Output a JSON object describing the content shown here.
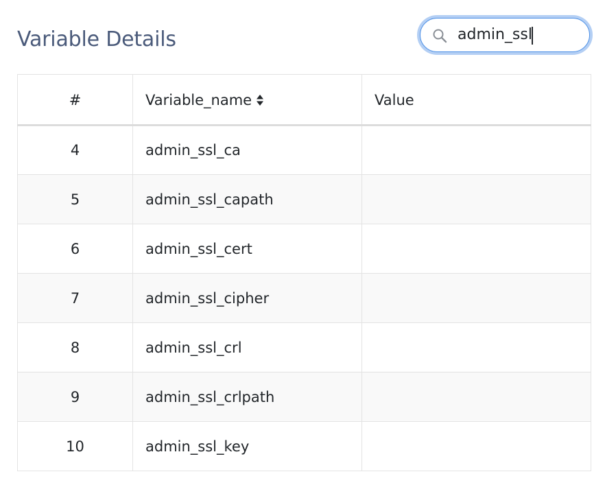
{
  "header": {
    "title": "Variable Details"
  },
  "search": {
    "value": "admin_ssl",
    "icon": "search-icon"
  },
  "table": {
    "columns": [
      "#",
      "Variable_name",
      "Value"
    ],
    "sort_icon": "sort-icon",
    "rows": [
      {
        "num": "4",
        "name": "admin_ssl_ca",
        "value": ""
      },
      {
        "num": "5",
        "name": "admin_ssl_capath",
        "value": ""
      },
      {
        "num": "6",
        "name": "admin_ssl_cert",
        "value": ""
      },
      {
        "num": "7",
        "name": "admin_ssl_cipher",
        "value": ""
      },
      {
        "num": "8",
        "name": "admin_ssl_crl",
        "value": ""
      },
      {
        "num": "9",
        "name": "admin_ssl_crlpath",
        "value": ""
      },
      {
        "num": "10",
        "name": "admin_ssl_key",
        "value": ""
      }
    ]
  },
  "colors": {
    "title": "#4a5a7a",
    "focus_ring": "#76a7eb",
    "stripe": "#f9f9f9",
    "border": "#e3e3e3"
  }
}
